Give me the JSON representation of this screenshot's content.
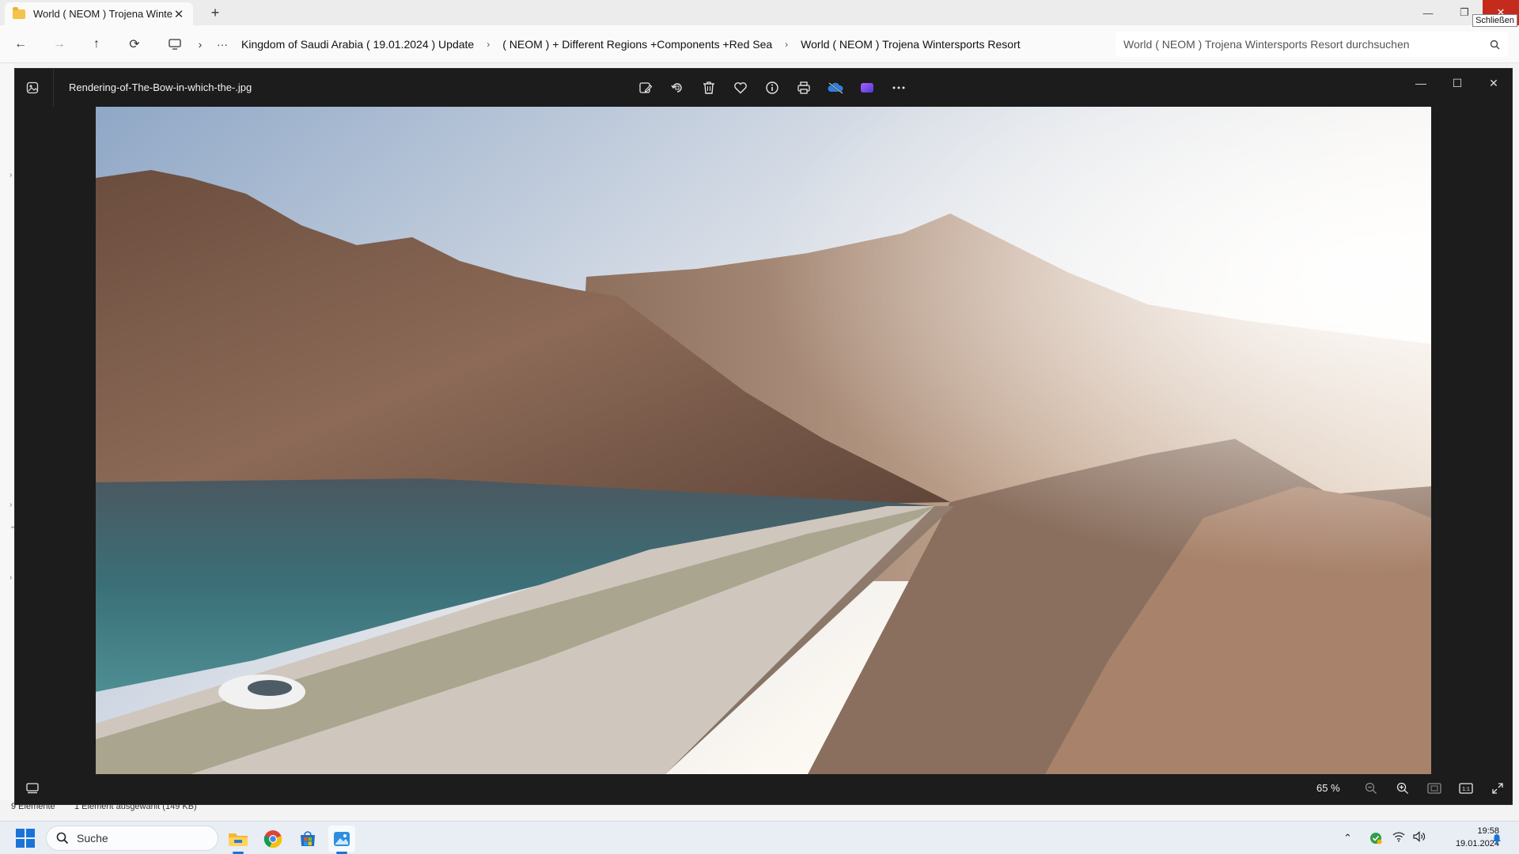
{
  "explorer": {
    "tab_title": "World ( NEOM ) Trojena Winte",
    "tab_close": "✕",
    "new_tab": "+",
    "close_tooltip": "Schließen",
    "window_buttons": {
      "minimize": "—",
      "restore": "❐",
      "close": "✕"
    },
    "nav": {
      "back": "←",
      "forward": "→",
      "up": "↑",
      "refresh": "⟳",
      "more": "···",
      "chevron": "›"
    },
    "breadcrumbs": [
      "Kingdom of Saudi Arabia ( 19.01.2024 ) Update",
      "( NEOM ) + Different Regions +Components +Red Sea",
      "World ( NEOM ) Trojena Wintersports Resort"
    ],
    "search_placeholder": "World ( NEOM ) Trojena Wintersports Resort durchsuchen",
    "status_items": "9 Elemente",
    "status_selected": "1 Element ausgewählt (149 KB)"
  },
  "viewer": {
    "file_name": "Rendering-of-The-Bow-in-which-the-.jpg",
    "toolbar_icons": [
      "edit-image-icon",
      "rotate-icon",
      "delete-icon",
      "favorite-heart-icon",
      "info-icon",
      "print-icon",
      "onedrive-icon",
      "clipchamp-icon",
      "more-options-icon"
    ],
    "window_buttons": {
      "minimize": "—",
      "maximize": "☐",
      "close": "✕"
    },
    "zoom_label": "65 %"
  },
  "taskbar": {
    "search_placeholder": "Suche",
    "apps": [
      "file-explorer-icon",
      "chrome-icon",
      "store-icon",
      "photos-icon"
    ],
    "time": "19:58",
    "date": "19.01.2024",
    "accent": "#1a73d9"
  }
}
